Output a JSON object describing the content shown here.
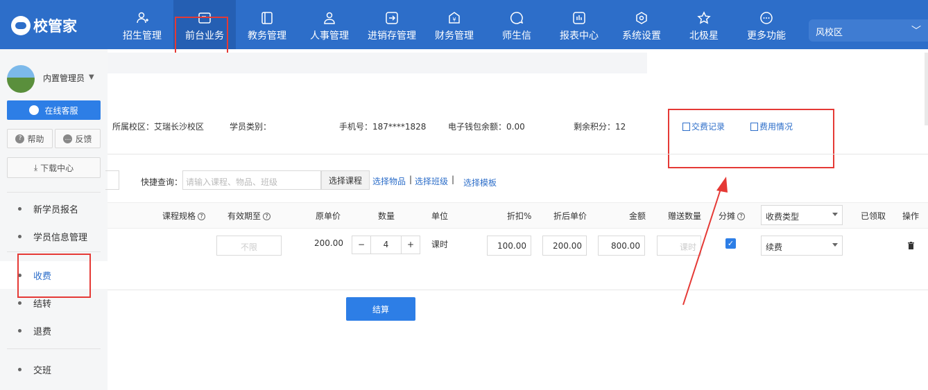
{
  "app": {
    "name": "校管家"
  },
  "nav": [
    {
      "label": "招生管理",
      "icon": "person-plus-icon"
    },
    {
      "label": "前台业务",
      "icon": "desk-icon"
    },
    {
      "label": "教务管理",
      "icon": "book-icon"
    },
    {
      "label": "人事管理",
      "icon": "person-icon"
    },
    {
      "label": "进销存管理",
      "icon": "arrow-box-icon"
    },
    {
      "label": "财务管理",
      "icon": "money-bag-icon"
    },
    {
      "label": "师生信",
      "icon": "chat-icon"
    },
    {
      "label": "报表中心",
      "icon": "report-icon"
    },
    {
      "label": "系统设置",
      "icon": "settings-icon"
    },
    {
      "label": "北极星",
      "icon": "star-icon"
    },
    {
      "label": "更多功能",
      "icon": "more-icon"
    }
  ],
  "campus_selector": {
    "value": "风校区"
  },
  "user": {
    "name": "内置管理员"
  },
  "sidebar": {
    "service_label": "在线客服",
    "help_label": "帮助",
    "feedback_label": "反馈",
    "download_label": "下载中心",
    "items": [
      "新学员报名",
      "学员信息管理",
      "收费",
      "结转",
      "退费",
      "交班"
    ],
    "active": "收费"
  },
  "student_info": {
    "campus": "所属校区：艾瑞长沙校区",
    "category": "学员类别：",
    "phone": "手机号：187****1828",
    "wallet": "电子钱包余额：0.00",
    "points": "剩余积分：12",
    "payment_record": "交费记录",
    "fee_status": "费用情况"
  },
  "quick_query": {
    "label": "快捷查询：",
    "placeholder": "请输入课程、物品、班级",
    "select_course": "选择课程",
    "select_item": "选择物品",
    "select_class": "选择班级",
    "select_template": "选择模板"
  },
  "table": {
    "headers": [
      "课程规格",
      "有效期至",
      "原单价",
      "数量",
      "单位",
      "折扣%",
      "折后单价",
      "金额",
      "赠送数量",
      "分摊",
      "收费类型",
      "已领取",
      "操作"
    ],
    "fee_type_header": "收费类型",
    "row": {
      "valid_until_placeholder": "不限",
      "unit_price": "200.00",
      "quantity": "4",
      "unit": "课时",
      "discount": "100.00",
      "discounted_price": "200.00",
      "amount": "800.00",
      "gift_placeholder": "课时",
      "apportion_checked": true,
      "fee_type": "续费"
    }
  },
  "settle_label": "结算",
  "colors": {
    "primary": "#2d6ec9",
    "button": "#2d7ee6",
    "highlight": "#e53935"
  }
}
